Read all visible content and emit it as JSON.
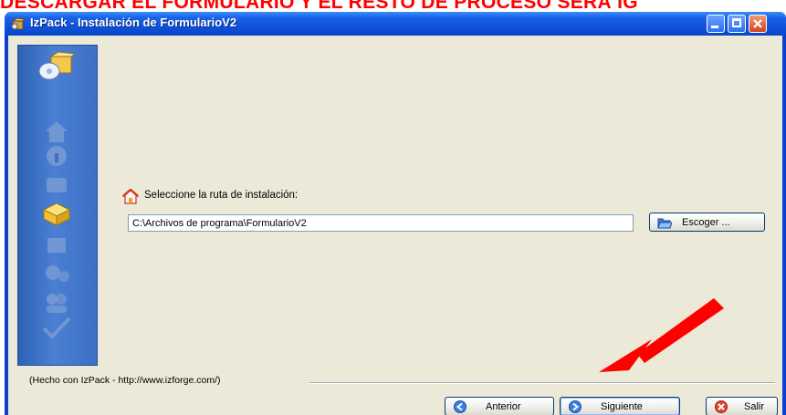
{
  "banner": {
    "text": "DESCARGAR EL FORMULARIO Y EL RESTO DE PROCESO SERÁ IG"
  },
  "window": {
    "title": "IzPack - Instalación de FormularioV2",
    "controls": [
      "minimize-icon",
      "maximize-icon",
      "close-icon"
    ]
  },
  "left_panel": {
    "icons": [
      "install-box-logo-icon",
      "home-step-icon",
      "info-step-icon",
      "licence-step-icon",
      "target-folder-step-icon",
      "packs-step-icon",
      "install-progress-step-icon",
      "users-step-icon",
      "finish-check-step-icon"
    ],
    "active_step": "target-folder-step-icon"
  },
  "main": {
    "prompt_label": "Seleccione la ruta de instalación:",
    "path_value": "C:\\Archivos de programa\\FormularioV2",
    "choose_button": "Escoger ..."
  },
  "footer": {
    "credit": "(Hecho con IzPack - http://www.izforge.com/)",
    "buttons": {
      "previous": "Anterior",
      "next": "Siguiente",
      "exit": "Salir"
    }
  },
  "annotation": {
    "arrow_color": "#ff0000",
    "target": "next-button"
  },
  "colors": {
    "banner": "#ff0000",
    "titlebar": "#0d4fd8",
    "client_bg": "#ece9d8",
    "side_panel": "#3d70c6"
  }
}
